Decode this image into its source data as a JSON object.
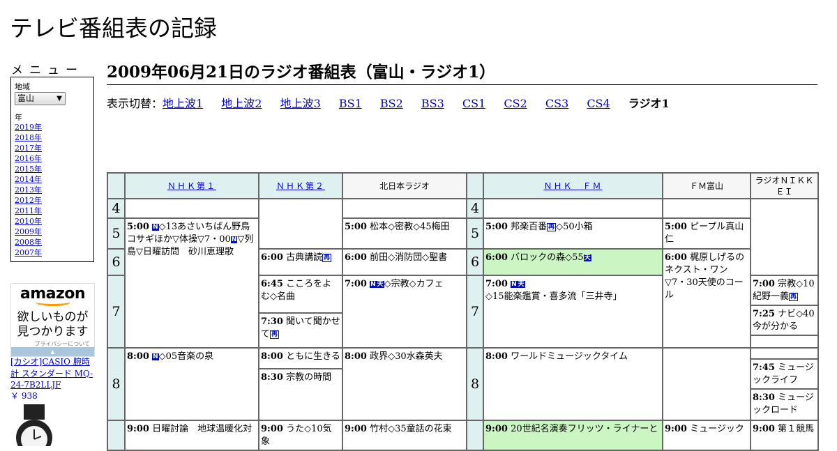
{
  "site_title": "テレビ番組表の記録",
  "menu": {
    "heading": "メニュー",
    "region_label": "地域",
    "region_value": "富山",
    "year_label": "年",
    "years": [
      "2019年",
      "2018年",
      "2017年",
      "2016年",
      "2015年",
      "2014年",
      "2013年",
      "2012年",
      "2011年",
      "2010年",
      "2009年",
      "2008年",
      "2007年"
    ]
  },
  "ad": {
    "logo": "amazon",
    "line1": "欲しいものが",
    "line2": "見つかります",
    "privacy": "プライバシーについて",
    "product": "[カシオ]CASIO 腕時計 スタンダード MQ-24-7B2LLJF",
    "price": "￥ 938"
  },
  "page_title": "2009年06月21日のラジオ番組表（富山・ラジオ1）",
  "switcher": {
    "label": "表示切替：",
    "links": [
      "地上波1",
      "地上波2",
      "地上波3",
      "BS1",
      "BS2",
      "BS3",
      "CS1",
      "CS2",
      "CS3",
      "CS4"
    ],
    "current": "ラジオ1"
  },
  "channels": [
    {
      "name": "ＮＨＫ第１",
      "link": true
    },
    {
      "name": "ＮＨＫ第２",
      "link": true
    },
    {
      "name": "北日本ラジオ",
      "link": false
    },
    {
      "name": "ＮＨＫ　ＦＭ",
      "link": true
    },
    {
      "name": "ＦＭ富山",
      "link": false
    },
    {
      "name": "ラジオＮＩＫＫＥＩ",
      "link": false
    }
  ],
  "hours": [
    "4",
    "5",
    "6",
    "7",
    "8"
  ],
  "programs": {
    "nhk1_0500": {
      "time": "5:00",
      "a": "◇13あさいちばん野鳥コサギほか▽体操▽7・00",
      "b": "▽列島▽日曜訪問　砂川恵理歌"
    },
    "nhk1_0800": {
      "time": "8:00",
      "a": "◇05音楽の泉"
    },
    "nhk1_0900": {
      "time": "9:00",
      "a": "日曜討論　地球温暖化対"
    },
    "nhk2_0600": {
      "time": "6:00",
      "a": "古典講読"
    },
    "nhk2_0645": {
      "time": "6:45",
      "a": "こころをよむ◇名曲"
    },
    "nhk2_0730": {
      "time": "7:30",
      "a": "聞いて聞かせて"
    },
    "nhk2_0800": {
      "time": "8:00",
      "a": "ともに生きる"
    },
    "nhk2_0830": {
      "time": "8:30",
      "a": "宗教の時間"
    },
    "nhk2_0900": {
      "time": "9:00",
      "a": "うた◇10気象"
    },
    "kita_0500": {
      "time": "5:00",
      "a": "松本◇密教◇45梅田"
    },
    "kita_0600": {
      "time": "6:00",
      "a": "前田◇消防団◇聖書"
    },
    "kita_0700": {
      "time": "7:00",
      "a": "◇宗教◇カフェ"
    },
    "kita_0800": {
      "time": "8:00",
      "a": "政界◇30水森英夫"
    },
    "kita_0900": {
      "time": "9:00",
      "a": "竹村◇35童話の花束"
    },
    "fm_0500": {
      "time": "5:00",
      "a": "邦楽百番",
      "b": "◇50小箱"
    },
    "fm_0600": {
      "time": "6:00",
      "a": "バロックの森◇55"
    },
    "fm_0700": {
      "time": "7:00",
      "a": "◇15能楽鑑賞・喜多流「三井寺」"
    },
    "fm_0800": {
      "time": "8:00",
      "a": "ワールドミュージックタイム"
    },
    "fm_0900": {
      "time": "9:00",
      "a": "20世紀名演奏フリッツ・ライナーと"
    },
    "fmt_0500": {
      "time": "5:00",
      "a": "ピープル真山仁"
    },
    "fmt_0600": {
      "time": "6:00",
      "a": "梶原しげるのネクスト・ワン▽7・30天使のコール"
    },
    "fmt_0900": {
      "time": "9:00",
      "a": "ミュージック"
    },
    "nik_0700": {
      "time": "7:00",
      "a": "宗教◇10紀野一義"
    },
    "nik_0725": {
      "time": "7:25",
      "a": "ナビ◇40今が分かる"
    },
    "nik_0745": {
      "time": "7:45",
      "a": "ミュージックライフ"
    },
    "nik_0830": {
      "time": "8:30",
      "a": "ミュージックロード"
    },
    "nik_0900": {
      "time": "9:00",
      "a": "第１競馬"
    }
  },
  "badges": {
    "news": "N",
    "weather": "天",
    "rerun": "再"
  },
  "colors": {
    "header_bg": "#dff0f0",
    "highlight": "#ccf5c4",
    "link": "#0000cc",
    "badge": "#0011aa"
  }
}
